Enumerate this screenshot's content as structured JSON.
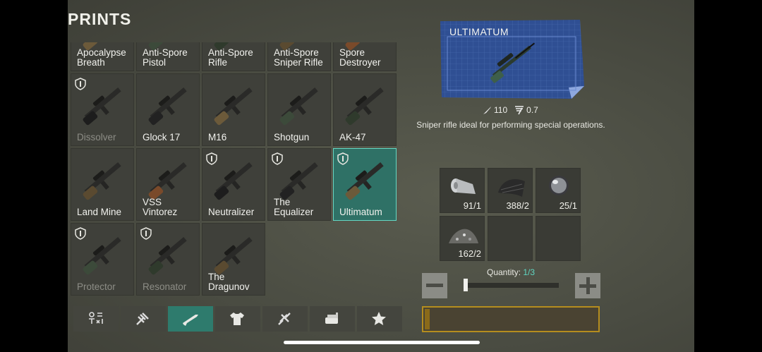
{
  "header": {
    "title": "PRINTS"
  },
  "blueprints": [
    {
      "label": "Apocalypse\nBreath",
      "dim": false,
      "badge": false,
      "selected": false
    },
    {
      "label": "Anti-Spore\nPistol",
      "dim": false,
      "badge": false,
      "selected": false
    },
    {
      "label": "Anti-Spore\nRifle",
      "dim": false,
      "badge": false,
      "selected": false
    },
    {
      "label": "Anti-Spore\nSniper Rifle",
      "dim": false,
      "badge": false,
      "selected": false
    },
    {
      "label": "Spore\nDestroyer",
      "dim": false,
      "badge": false,
      "selected": false
    },
    {
      "label": "Dissolver",
      "dim": true,
      "badge": true,
      "selected": false
    },
    {
      "label": "Glock 17",
      "dim": false,
      "badge": false,
      "selected": false
    },
    {
      "label": "M16",
      "dim": false,
      "badge": false,
      "selected": false
    },
    {
      "label": "Shotgun",
      "dim": false,
      "badge": false,
      "selected": false
    },
    {
      "label": "AK-47",
      "dim": false,
      "badge": false,
      "selected": false
    },
    {
      "label": "Land Mine",
      "dim": false,
      "badge": false,
      "selected": false
    },
    {
      "label": "VSS Vintorez",
      "dim": false,
      "badge": false,
      "selected": false
    },
    {
      "label": "Neutralizer",
      "dim": false,
      "badge": true,
      "selected": false
    },
    {
      "label": "The\nEqualizer",
      "dim": false,
      "badge": true,
      "selected": false
    },
    {
      "label": "Ultimatum",
      "dim": false,
      "badge": true,
      "selected": true
    },
    {
      "label": "Protector",
      "dim": true,
      "badge": true,
      "selected": false
    },
    {
      "label": "Resonator",
      "dim": true,
      "badge": true,
      "selected": false
    },
    {
      "label": "The\nDragunov",
      "dim": false,
      "badge": false,
      "selected": false
    }
  ],
  "category_tabs": [
    {
      "icon": "all-categories-icon",
      "active": false
    },
    {
      "icon": "tools-icon",
      "active": false
    },
    {
      "icon": "weapons-icon",
      "active": true
    },
    {
      "icon": "clothing-icon",
      "active": false
    },
    {
      "icon": "components-icon",
      "active": false
    },
    {
      "icon": "furniture-icon",
      "active": false
    },
    {
      "icon": "favorites-star-icon",
      "active": false
    }
  ],
  "detail": {
    "name": "ULTIMATUM",
    "damage": "110",
    "fire_rate": "0.7",
    "description": "Sniper rifle ideal for performing special operations."
  },
  "resources": [
    {
      "icon": "fabric-roll-icon",
      "count": "91/1"
    },
    {
      "icon": "rubber-sheet-icon",
      "count": "388/2"
    },
    {
      "icon": "lens-icon",
      "count": "25/1"
    },
    {
      "icon": "gravel-pile-icon",
      "count": "162/2"
    },
    {
      "icon": "",
      "count": ""
    },
    {
      "icon": "",
      "count": ""
    }
  ],
  "quantity": {
    "label": "Quantity:",
    "value": "1/3",
    "fraction": 0.333
  },
  "craft": {
    "progress": 0.03
  },
  "colors": {
    "accent": "#2e7b6d",
    "selected_border": "#64d8c4",
    "craft_border": "#b58d1e"
  }
}
